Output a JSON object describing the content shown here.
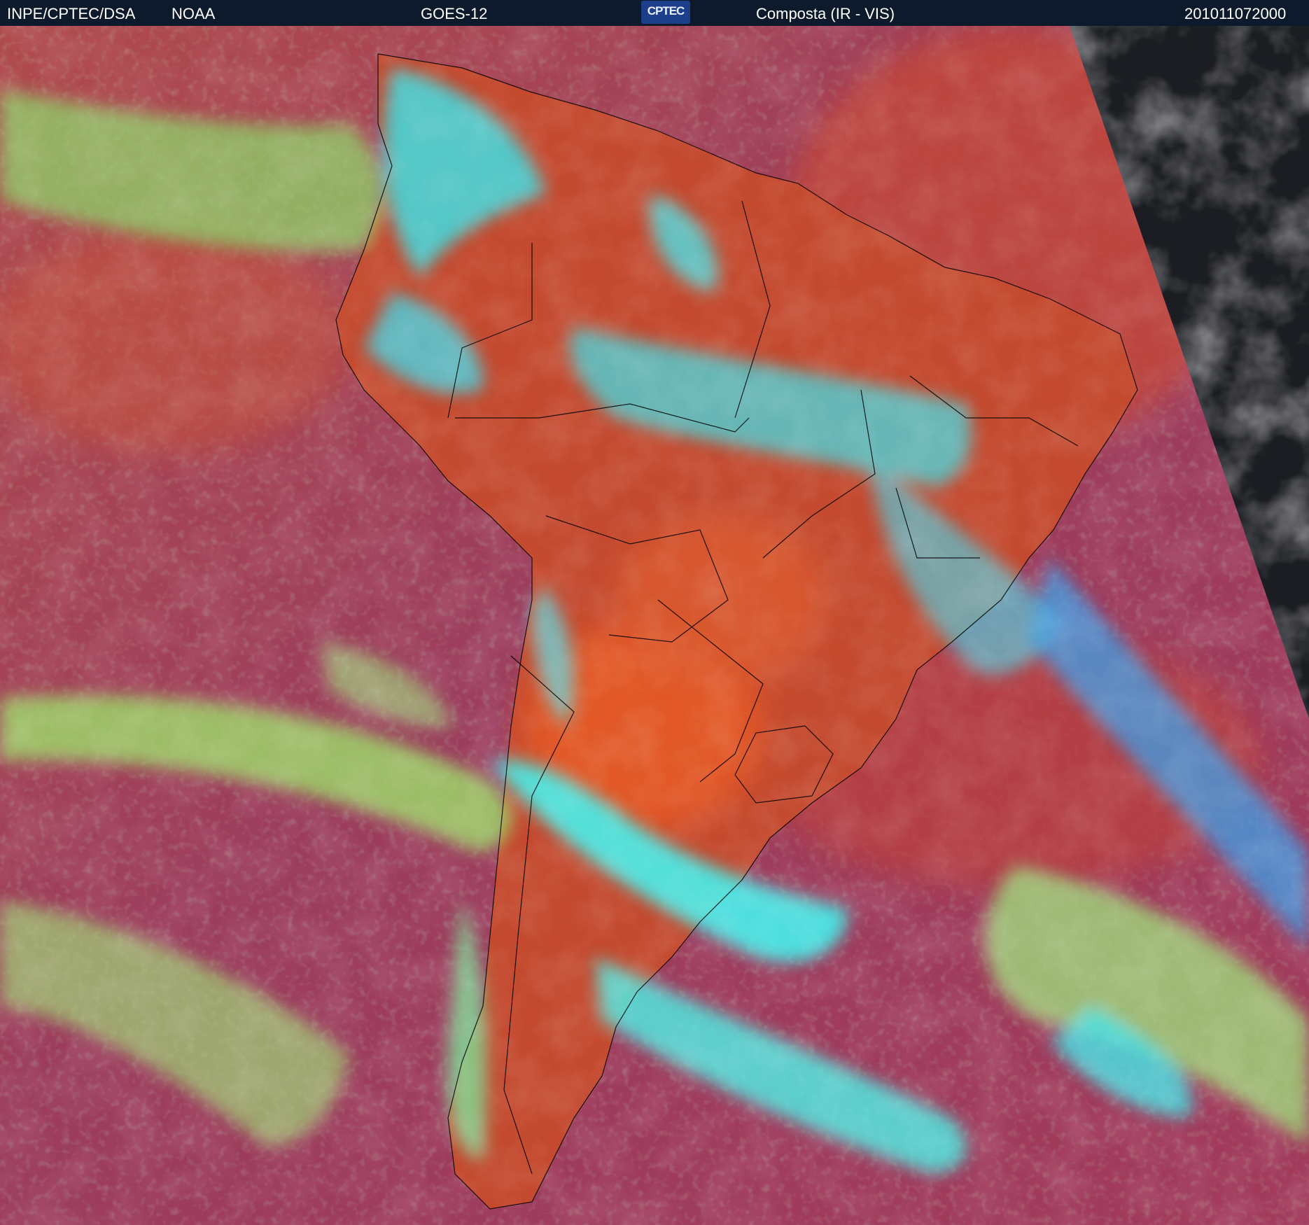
{
  "header": {
    "agency": "INPE/CPTEC/DSA",
    "partner": "NOAA",
    "satellite": "GOES-12",
    "logo_text": "CPTEC",
    "product": "Composta (IR - VIS)",
    "timestamp": "201011072000"
  },
  "image": {
    "description": "satellite-composite-south-america",
    "colors": {
      "ocean_clear": "#9c3d5e",
      "land_clear": "#c9452c",
      "land_hot": "#e8582c",
      "low_cloud": "#7fd07a",
      "high_cloud": "#3ef0f0",
      "night_side": "#1a1c20",
      "coastline": "#000000"
    }
  }
}
